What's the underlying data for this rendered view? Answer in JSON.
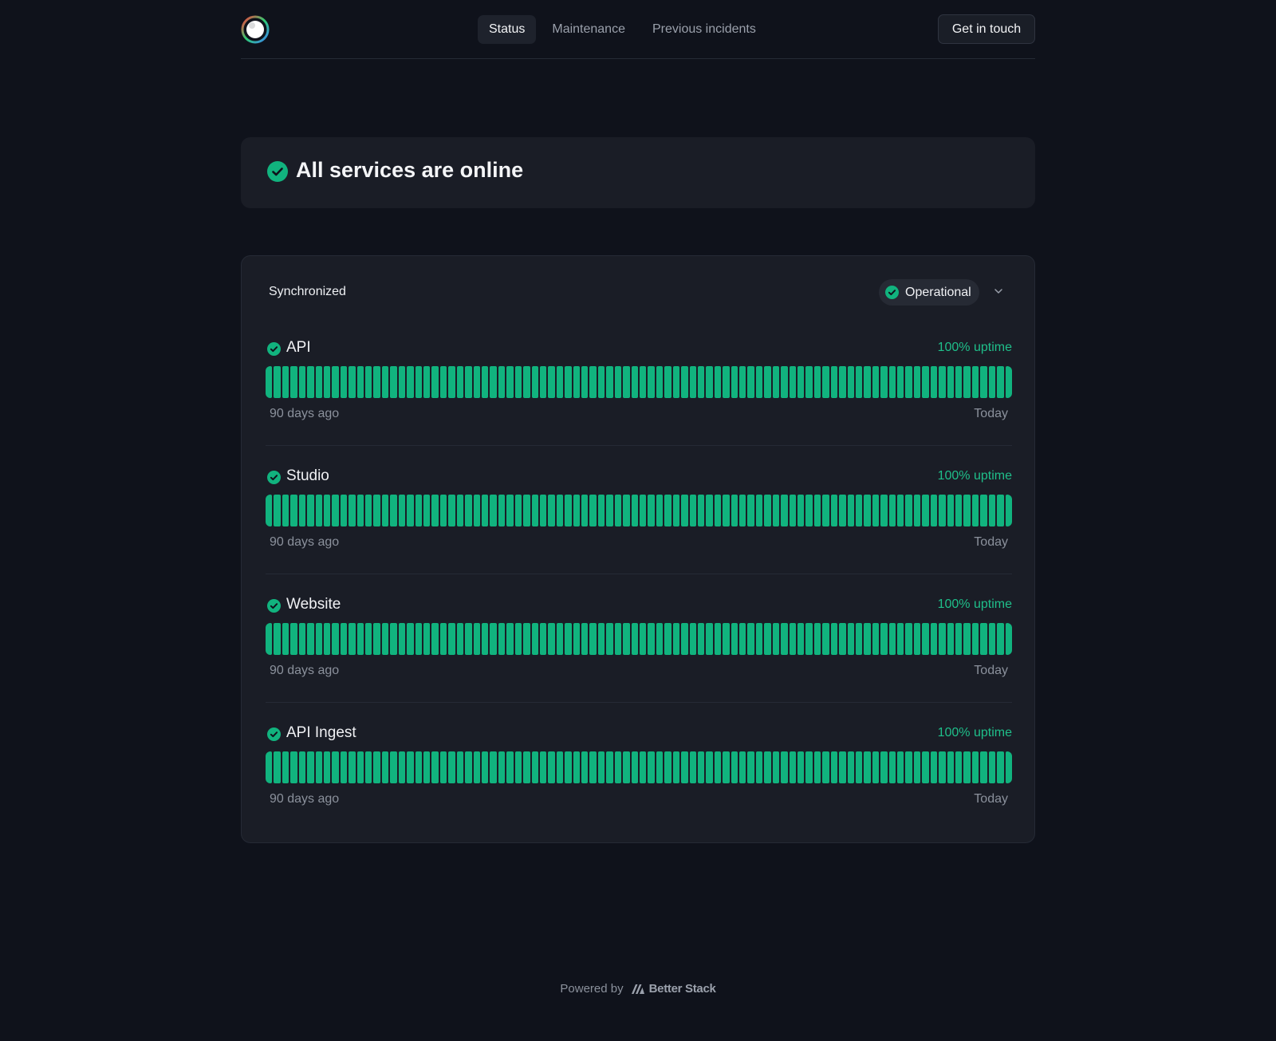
{
  "colors": {
    "accent": "#11b37e",
    "background": "#0f121b",
    "surface": "#1a1d26"
  },
  "header": {
    "nav": [
      "Status",
      "Maintenance",
      "Previous incidents"
    ],
    "active_nav": "Status",
    "contact_label": "Get in touch"
  },
  "status": {
    "title": "All services are online",
    "icon": "check-circle-icon"
  },
  "group": {
    "name": "Synchronized",
    "badge": "Operational",
    "monitors": [
      {
        "name": "API",
        "uptime": "100% uptime",
        "range_start": "90 days ago",
        "range_end": "Today",
        "days_up_fraction": 1.0
      },
      {
        "name": "Studio",
        "uptime": "100% uptime",
        "range_start": "90 days ago",
        "range_end": "Today",
        "days_up_fraction": 1.0
      },
      {
        "name": "Website",
        "uptime": "100% uptime",
        "range_start": "90 days ago",
        "range_end": "Today",
        "days_up_fraction": 1.0
      },
      {
        "name": "API Ingest",
        "uptime": "100% uptime",
        "range_start": "90 days ago",
        "range_end": "Today",
        "days_up_fraction": 1.0
      }
    ]
  },
  "footer": {
    "powered_by": "Powered by",
    "brand": "Better Stack"
  }
}
